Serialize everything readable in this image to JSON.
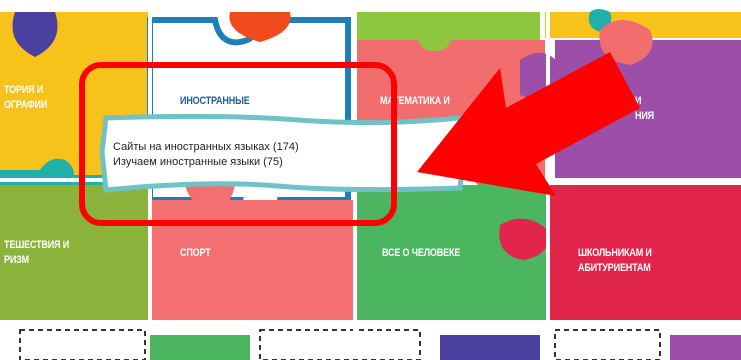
{
  "categories": {
    "history": "ТОРИЯ И\nОГРАФИИ",
    "foreign": "ИНОСТРАННЫЕ",
    "math": "МАТЕМАТИКА И",
    "science": "И\nНИЯ",
    "travel": "ТЕШЕСТВИЯ И\nРИЗМ",
    "sport": "СПОРТ",
    "human": "ВСЕ О ЧЕЛОВЕКЕ",
    "school": "ШКОЛЬНИКАМ И\nАБИТУРИЕНТАМ"
  },
  "tooltip": {
    "links": [
      "Сайты на иностранных языках (174)",
      "Изучаем иностранные языки (75)"
    ]
  },
  "colors": {
    "purple_top": "#4b3fa0",
    "yellow": "#f7c21a",
    "teal": "#1fb0a8",
    "white_piece": "#ffffff",
    "light_blue_border": "#1e7fb8",
    "orange": "#f04a1d",
    "green_light": "#8cc63f",
    "pink_salmon": "#f26d6d",
    "purple": "#9c4fa8",
    "olive_green": "#8bb23a",
    "coral": "#f36f72",
    "green": "#4cb55f",
    "crimson": "#e2254a",
    "highlight_red": "#ff0000"
  },
  "icons": [
    "red-arrow-icon",
    "dashed-puzzle-outline-icon"
  ]
}
